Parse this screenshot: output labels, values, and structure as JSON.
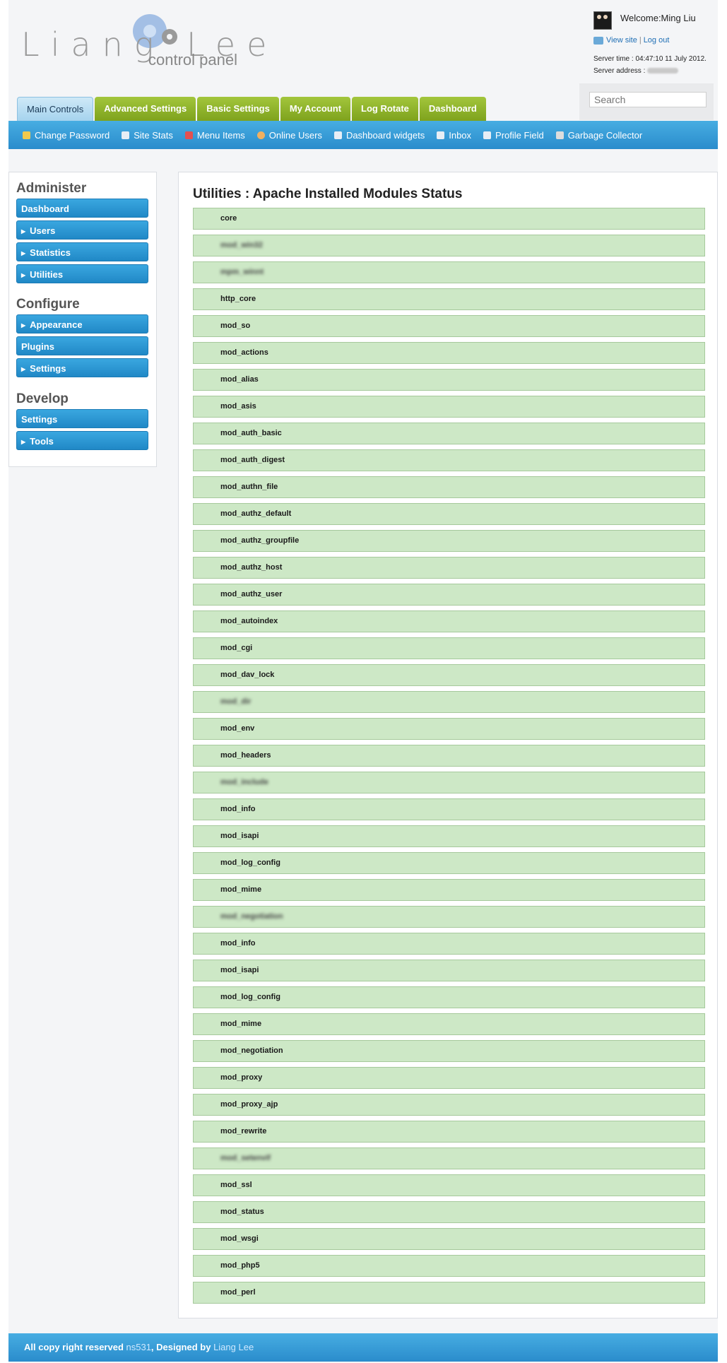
{
  "brand": {
    "name": "Liang Lee",
    "sub": "control panel"
  },
  "user": {
    "welcome": "Welcome:Ming Liu",
    "view_site": "View site",
    "log_out": "Log out",
    "server_time": "Server time : 04:47:10 11 July 2012.",
    "server_address_label": "Server address :"
  },
  "search": {
    "placeholder": "Search"
  },
  "tabs": [
    {
      "label": "Main Controls"
    },
    {
      "label": "Advanced Settings"
    },
    {
      "label": "Basic Settings"
    },
    {
      "label": "My Account"
    },
    {
      "label": "Log Rotate"
    },
    {
      "label": "Dashboard"
    }
  ],
  "subnav": [
    {
      "label": "Change Password",
      "icon": "lock-icon"
    },
    {
      "label": "Site Stats",
      "icon": "chat-icon"
    },
    {
      "label": "Menu Items",
      "icon": "menu-icon"
    },
    {
      "label": "Online Users",
      "icon": "user-icon"
    },
    {
      "label": "Dashboard widgets",
      "icon": "widget-icon"
    },
    {
      "label": "Inbox",
      "icon": "mail-icon"
    },
    {
      "label": "Profile Field",
      "icon": "field-icon"
    },
    {
      "label": "Garbage Collector",
      "icon": "trash-icon"
    }
  ],
  "sidebar": {
    "administer": "Administer",
    "configure": "Configure",
    "develop": "Develop",
    "items": [
      {
        "label": "Dashboard"
      },
      {
        "label": "Users"
      },
      {
        "label": "Statistics"
      },
      {
        "label": "Utilities"
      },
      {
        "label": "Appearance"
      },
      {
        "label": "Plugins"
      },
      {
        "label": "Settings"
      },
      {
        "label": "Settings"
      },
      {
        "label": "Tools"
      }
    ]
  },
  "main": {
    "title": "Utilities : Apache Installed Modules Status",
    "modules": [
      "core",
      "mod_win32",
      "mpm_winnt",
      "http_core",
      "mod_so",
      "mod_actions",
      "mod_alias",
      "mod_asis",
      "mod_auth_basic",
      "mod_auth_digest",
      "mod_authn_file",
      "mod_authz_default",
      "mod_authz_groupfile",
      "mod_authz_host",
      "mod_authz_user",
      "mod_autoindex",
      "mod_cgi",
      "mod_dav_lock",
      "mod_dir",
      "mod_env",
      "mod_headers",
      "mod_include",
      "mod_info",
      "mod_isapi",
      "mod_log_config",
      "mod_mime",
      "mod_negotiation",
      "mod_info",
      "mod_isapi",
      "mod_log_config",
      "mod_mime",
      "mod_negotiation",
      "mod_proxy",
      "mod_proxy_ajp",
      "mod_rewrite",
      "mod_setenvif",
      "mod_ssl",
      "mod_status",
      "mod_wsgi",
      "mod_php5",
      "mod_perl"
    ]
  },
  "footer": {
    "prefix": "All copy right reserved ",
    "owner": "ns531",
    "middle": ", Designed by ",
    "designer": "Liang Lee"
  }
}
